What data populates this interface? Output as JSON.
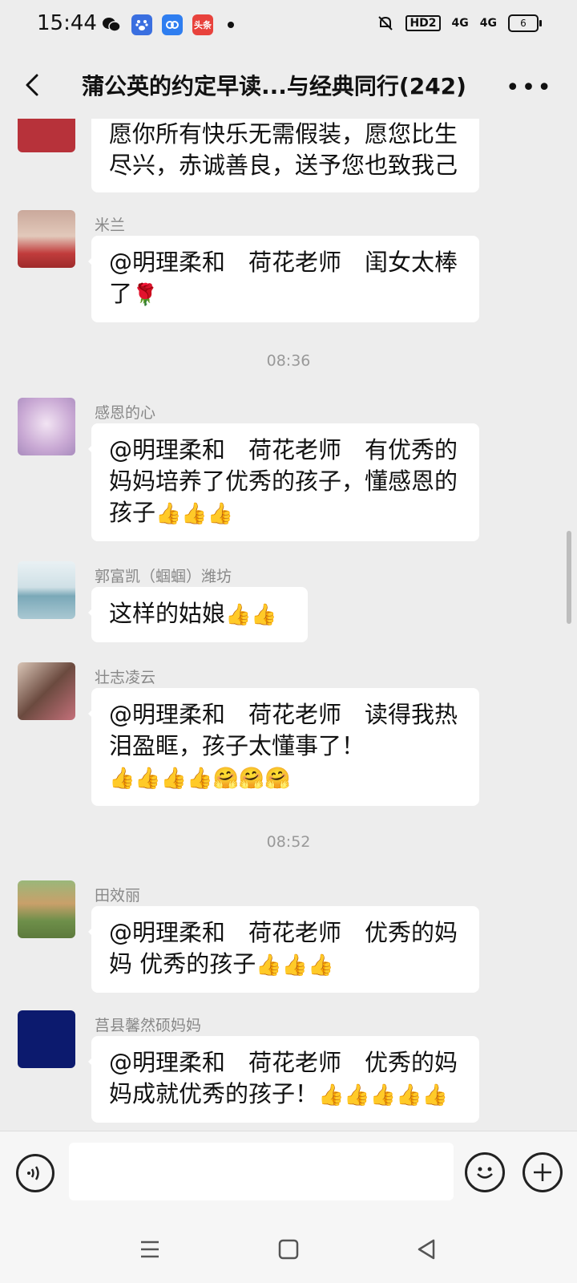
{
  "status_bar": {
    "time": "15:44",
    "apps": [
      "wechat-icon",
      "baidu-icon",
      "chat-app-icon",
      "toutiao-icon"
    ],
    "toutiao_label": "头条",
    "network1": "HD2",
    "signal1": "4G",
    "signal2": "4G",
    "battery": "6"
  },
  "header": {
    "title": "蒲公英的约定早读...与经典同行(242)"
  },
  "messages": [
    {
      "name": "",
      "text": "愿你所有快乐无需假装，愿您比生尽兴，赤诚善良，送予您也致我己"
    },
    {
      "name": "米兰",
      "text": "@明理柔和　荷花老师　闺女太棒了",
      "emoji": "🌹"
    },
    {
      "time": "08:36"
    },
    {
      "name": "感恩的心",
      "text": "@明理柔和　荷花老师　有优秀的妈妈培养了优秀的孩子，懂感恩的孩子",
      "emoji": "👍👍👍"
    },
    {
      "name": "郭富凯（蝈蝈）潍坊",
      "text": "这样的姑娘",
      "emoji": "👍👍"
    },
    {
      "name": "壮志凌云",
      "text": "@明理柔和　荷花老师　读得我热泪盈眶，孩子太懂事了！",
      "emoji": "👍👍👍👍🤗🤗🤗"
    },
    {
      "time": "08:52"
    },
    {
      "name": "田效丽",
      "text": "@明理柔和　荷花老师　优秀的妈妈 优秀的孩子",
      "emoji": "👍👍👍"
    },
    {
      "name": "莒县馨然硕妈妈",
      "text": "@明理柔和　荷花老师　优秀的妈妈成就优秀的孩子！",
      "emoji": "👍👍👍👍👍"
    }
  ],
  "input": {
    "placeholder": ""
  },
  "colors": {
    "background": "#ededed",
    "bubble": "#ffffff",
    "name_text": "#888888"
  }
}
